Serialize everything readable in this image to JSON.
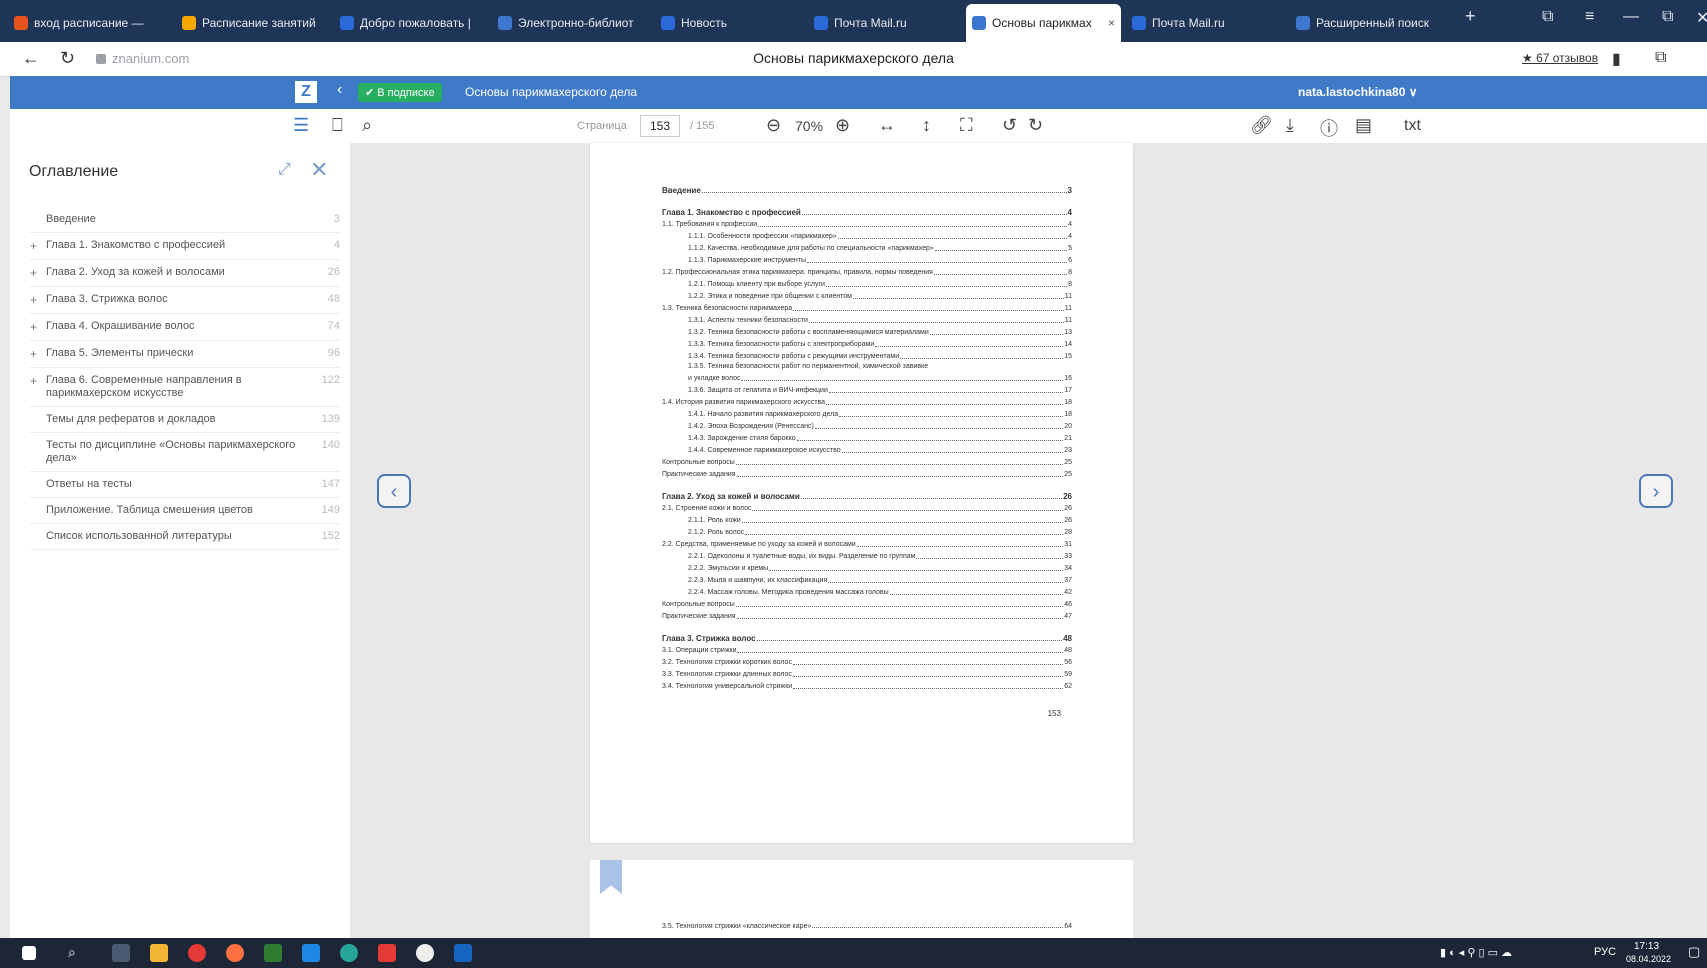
{
  "browser": {
    "tabs": [
      {
        "label": "вход расписание —",
        "color": "#e8541b"
      },
      {
        "label": "Расписание занятий",
        "color": "#f6a800"
      },
      {
        "label": "Добро пожаловать |",
        "color": "#2a6ad8"
      },
      {
        "label": "Электронно-библиот",
        "color": "#3d78d0"
      },
      {
        "label": "Новость",
        "color": "#2a6ad8"
      },
      {
        "label": "Почта Mail.ru",
        "color": "#2a6ad8"
      },
      {
        "label": "Основы парикмах",
        "color": "#3d78d0",
        "active": true
      },
      {
        "label": "Почта Mail.ru",
        "color": "#2a6ad8"
      },
      {
        "label": "Расширенный поиск",
        "color": "#3d78d0"
      }
    ],
    "new_tab": "+",
    "address": "znanium.com",
    "page_title": "Основы парикмахерского дела",
    "reviews": "★ 67 отзывов"
  },
  "reader": {
    "logo": "Z",
    "subscription_badge": "✔ В подписке",
    "book_title": "Основы парикмахерского дела",
    "user": "nata.lastochkina80 ∨"
  },
  "toolbar": {
    "page_label": "Страница",
    "page_current": "153",
    "page_total": "/ 155",
    "zoom": "70%",
    "txt": "txt"
  },
  "sidebar": {
    "title": "Оглавление",
    "items": [
      {
        "label": "Введение",
        "page": "3",
        "expandable": false
      },
      {
        "label": "Глава 1. Знакомство с профессией",
        "page": "4",
        "expandable": true
      },
      {
        "label": "Глава 2. Уход за кожей и волосами",
        "page": "26",
        "expandable": true
      },
      {
        "label": "Глава 3. Стрижка волос",
        "page": "48",
        "expandable": true
      },
      {
        "label": "Глава 4. Окрашивание волос",
        "page": "74",
        "expandable": true
      },
      {
        "label": "Глава 5. Элементы прически",
        "page": "96",
        "expandable": true
      },
      {
        "label": "Глава 6. Современные направления в парикмахерском искусстве",
        "page": "122",
        "expandable": true
      },
      {
        "label": "Темы для рефератов и докладов",
        "page": "139",
        "expandable": false
      },
      {
        "label": "Тесты по дисциплине «Основы парикмахерского дела»",
        "page": "140",
        "expandable": false
      },
      {
        "label": "Ответы на тесты",
        "page": "147",
        "expandable": false
      },
      {
        "label": "Приложение. Таблица смешения цветов",
        "page": "149",
        "expandable": false
      },
      {
        "label": "Список использованной литературы",
        "page": "152",
        "expandable": false
      }
    ]
  },
  "document": {
    "toc": [
      {
        "text": "Введение",
        "page": "3",
        "level": 0,
        "chapter": true
      },
      {
        "text": "Глава 1. Знакомство с профессией",
        "page": "4",
        "level": 0,
        "chapter": true
      },
      {
        "text": "1.1.   Требования к профессии",
        "page": "4",
        "level": 1
      },
      {
        "text": "1.1.1.   Особенности профессии «парикмахер»",
        "page": "4",
        "level": 2
      },
      {
        "text": "1.1.2.   Качества, необходимые для работы по специальности «парикмахер»",
        "page": "5",
        "level": 2
      },
      {
        "text": "1.1.3.   Парикмахерские инструменты",
        "page": "6",
        "level": 2
      },
      {
        "text": "1.2.   Профессиональная этика парикмахера: принципы, правила, нормы поведения",
        "page": "8",
        "level": 1
      },
      {
        "text": "1.2.1.   Помощь клиенту при выборе услуги",
        "page": "8",
        "level": 2
      },
      {
        "text": "1.2.2.   Этика и поведение при общении с клиентом",
        "page": "11",
        "level": 2
      },
      {
        "text": "1.3.   Техника безопасности парикмахера",
        "page": "11",
        "level": 1
      },
      {
        "text": "1.3.1.   Аспекты техники безопасности",
        "page": "11",
        "level": 2
      },
      {
        "text": "1.3.2.   Техника безопасности работы с воспламеняющимися материалами",
        "page": "13",
        "level": 2
      },
      {
        "text": "1.3.3.   Техника безопасности работы с электроприборами",
        "page": "14",
        "level": 2
      },
      {
        "text": "1.3.4.   Техника безопасности работы с режущими инструментами",
        "page": "15",
        "level": 2
      },
      {
        "text": "1.3.5.   Техника безопасности работ по перманентной, химической завивке",
        "page": "",
        "level": 2,
        "wrap": true
      },
      {
        "text": "и укладке волос",
        "page": "16",
        "level": 3
      },
      {
        "text": "1.3.6.   Защита от гепатита и ВИЧ-инфекции",
        "page": "17",
        "level": 2
      },
      {
        "text": "1.4.   История развития парикмахерского искусства",
        "page": "18",
        "level": 1
      },
      {
        "text": "1.4.1.   Начало развития парикмахерского дела",
        "page": "18",
        "level": 2
      },
      {
        "text": "1.4.2.   Эпоха Возрождения (Ренессанс)",
        "page": "20",
        "level": 2
      },
      {
        "text": "1.4.3.   Зарождение стиля барокко",
        "page": "21",
        "level": 2
      },
      {
        "text": "1.4.4.   Современное парикмахерское искусство",
        "page": "23",
        "level": 2
      },
      {
        "text": "Контрольные вопросы",
        "page": "25",
        "level": 0
      },
      {
        "text": "Практические задания",
        "page": "25",
        "level": 0
      },
      {
        "text": "Глава 2. Уход за кожей и волосами",
        "page": "26",
        "level": 0,
        "chapter": true
      },
      {
        "text": "2.1.   Строение кожи и волос",
        "page": "26",
        "level": 1
      },
      {
        "text": "2.1.1.   Роль кожи",
        "page": "26",
        "level": 2
      },
      {
        "text": "2.1.2.   Роль волос",
        "page": "28",
        "level": 2
      },
      {
        "text": "2.2.   Средства, применяемые по уходу за кожей и волосами",
        "page": "31",
        "level": 1
      },
      {
        "text": "2.2.1.   Одеколоны и туалетные воды, их виды. Разделение по группам",
        "page": "33",
        "level": 2
      },
      {
        "text": "2.2.2.   Эмульсии и кремы",
        "page": "34",
        "level": 2
      },
      {
        "text": "2.2.3.   Мыла и шампуни, их классификация",
        "page": "37",
        "level": 2
      },
      {
        "text": "2.2.4.   Массаж головы. Методика проведения массажа головы",
        "page": "42",
        "level": 2
      },
      {
        "text": "Контрольные вопросы",
        "page": "46",
        "level": 0
      },
      {
        "text": "Практические задания",
        "page": "47",
        "level": 0
      },
      {
        "text": "Глава 3. Стрижка волос",
        "page": "48",
        "level": 0,
        "chapter": true
      },
      {
        "text": "3.1.   Операции стрижки",
        "page": "48",
        "level": 1
      },
      {
        "text": "3.2.   Технология стрижки коротких волос",
        "page": "56",
        "level": 1
      },
      {
        "text": "3.3.   Технология стрижки длинных волос",
        "page": "59",
        "level": 1
      },
      {
        "text": "3.4.   Технология универсальной стрижки",
        "page": "62",
        "level": 1
      }
    ],
    "page_number": "153",
    "next_page_line": {
      "text": "3.5.   Технология стрижки «классическое каре»",
      "page": "64"
    }
  },
  "taskbar": {
    "lang": "РУС",
    "time": "17:13",
    "date": "08.04.2022"
  }
}
